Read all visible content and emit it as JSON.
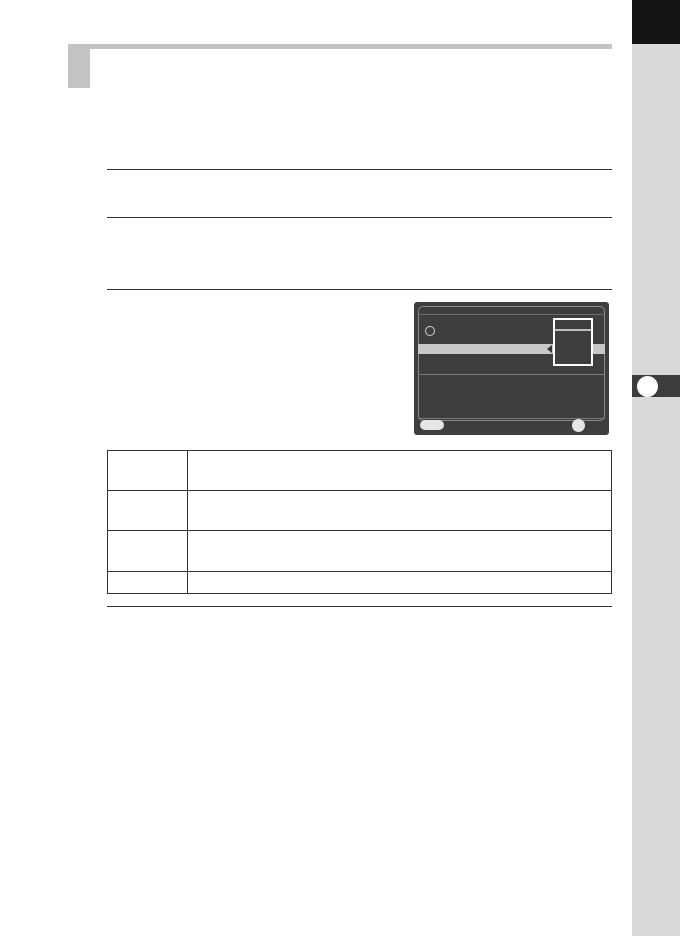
{
  "header": {
    "title": ""
  },
  "camera_screen": {
    "menu_button_label": "",
    "ok_button_label": ""
  },
  "options_table": {
    "rows": [
      {
        "key": "",
        "description": ""
      },
      {
        "key": "",
        "description": ""
      },
      {
        "key": "",
        "description": ""
      },
      {
        "key": "",
        "description": ""
      }
    ]
  },
  "sidebar": {
    "chapter_number": ""
  },
  "colors": {
    "side_strip": "#d9d9d9",
    "side_top": "#141414",
    "header_bar": "#c4c4c4",
    "camera_bg": "#3e3e3e",
    "highlight_row": "#c8c8c8"
  }
}
